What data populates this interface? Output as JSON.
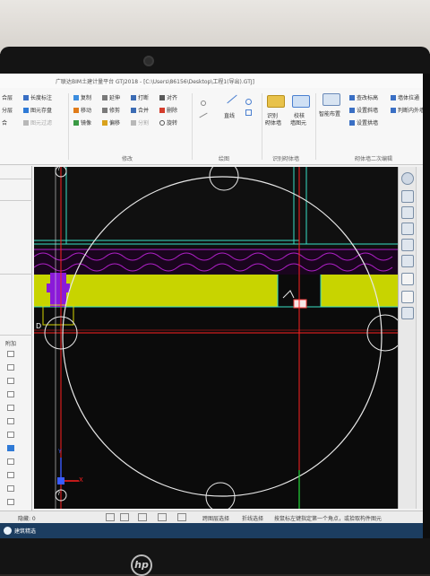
{
  "window": {
    "title": "广联达BIM土建计量平台 GTJ2018 - [C:\\Users\\86156\\Desktop\\工程1(导出).GTJ]"
  },
  "ribbon": {
    "col1": [
      "合层",
      "分层",
      "合"
    ],
    "col2": [
      "长度标注",
      "图元存盘",
      "图元过滤"
    ],
    "col3": [
      "复制",
      "移动",
      "镜像"
    ],
    "col4": [
      "延伸",
      "修剪",
      "偏移"
    ],
    "col5": [
      "打断",
      "合并",
      "分割"
    ],
    "col6": [
      "对齐",
      "删除",
      "旋转"
    ],
    "draw_label": "直线",
    "identify_wall": [
      "识别",
      "砌体墙"
    ],
    "check_wall": [
      "校核",
      "墙图元"
    ],
    "smart_layout": "智能布置",
    "wall_edit": [
      "查改标高",
      "设置斜墙",
      "设置拱墙"
    ],
    "wall_edit_right": [
      "墙体拉通",
      "判断内外墙"
    ],
    "groups": {
      "modify": "修改",
      "draw": "绘图",
      "identify": "识别砌体墙",
      "second_edit": "砌体墙二次编辑"
    }
  },
  "left_panel": {
    "attach_label": "附加",
    "checkbox_states": [
      false,
      false,
      false,
      false,
      false,
      false,
      false,
      true,
      false,
      false,
      false,
      false
    ]
  },
  "canvas": {
    "axis_labels": {
      "top": "?",
      "left": "D",
      "bottom": "?"
    },
    "axis_y_label": "Y",
    "axis_x_label": "X",
    "colors": {
      "background": "#0b0b0b",
      "grid_white": "#e8e8e8",
      "wall_green": "#c8d400",
      "wall_outline": "#39e0c6",
      "axis_red": "#ff2020",
      "hatch_magenta": "#b020c8",
      "column_purple": "#8a1ad9"
    }
  },
  "status_bar": {
    "left": "隐藏: 0",
    "mode1": "跨图层选择",
    "mode2": "折线选择",
    "hint": "按鼠标左键指定第一个角点，或拾取构件图元"
  },
  "taskbar": {
    "app": "建筑精选"
  },
  "laptop": {
    "brand": "hp"
  }
}
